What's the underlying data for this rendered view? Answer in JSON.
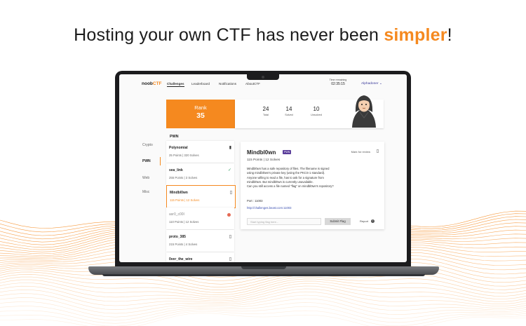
{
  "headline": {
    "before": "Hosting your own CTF has never been ",
    "highlight": "simpler",
    "after": "!"
  },
  "colors": {
    "accent": "#f5891f",
    "tag": "#5a3d9a",
    "solved": "#2e9b5c",
    "alert": "#e56a54"
  },
  "app": {
    "logo": {
      "part1": "noob",
      "part2": "CTF"
    },
    "nav": [
      "Challenges",
      "Leaderboard",
      "Notifications",
      "AboutCTF"
    ],
    "timer": {
      "label": "Time remaining",
      "value": "02:35:15"
    },
    "user": "Alphadoner",
    "rank": {
      "label": "Rank",
      "value": "35"
    },
    "stats": [
      {
        "value": "24",
        "label": "Total"
      },
      {
        "value": "14",
        "label": "Solved"
      },
      {
        "value": "10",
        "label": "Unsolved"
      }
    ],
    "section_title": "PWN",
    "categories": [
      "Crypto",
      "PWN",
      "Web",
      "Misc"
    ],
    "challenges": [
      {
        "name": "Polynomial",
        "meta": "25 Points | 320 Solves",
        "icon": "bookmark-filled-icon"
      },
      {
        "name": "sea_link",
        "meta": "255 Points | 3 Solves",
        "icon": "check-icon"
      },
      {
        "name": "Mindbl0wn",
        "meta": "115 Points | 12 Solves",
        "icon": "bookmark-icon"
      },
      {
        "name": "asr0_c00l",
        "meta": "110 Points | 12 Solves",
        "icon": "alert-icon"
      },
      {
        "name": "proto_385",
        "meta": "215 Points | 4 Solves",
        "icon": "bookmark-icon"
      },
      {
        "name": "0ver_the_wire",
        "meta": "",
        "icon": "bookmark-icon"
      }
    ],
    "detail": {
      "title": "Mindbl0wn",
      "tag": "PWN",
      "hint": "Mark for review",
      "points": "115 Points | 12 Solves",
      "desc_lines": [
        "Mindbl0wn has a safe repository of files. The filename is signed",
        "using mindbl0wn's private key (using the PKCS-1 standard).",
        "Anyone willing to read a file, has to ask for a signature from",
        "mindbl0wn. But mindbl0wn is currently unavailable.",
        "Can you still access a file named \"flag\" on mindbl0wn's repository?"
      ],
      "port": "Port : 11003",
      "url": "http://challenges.beast.com:11003",
      "flag_placeholder": "Start typing flag here...",
      "submit": "Submit Flag",
      "report": "Report"
    }
  }
}
